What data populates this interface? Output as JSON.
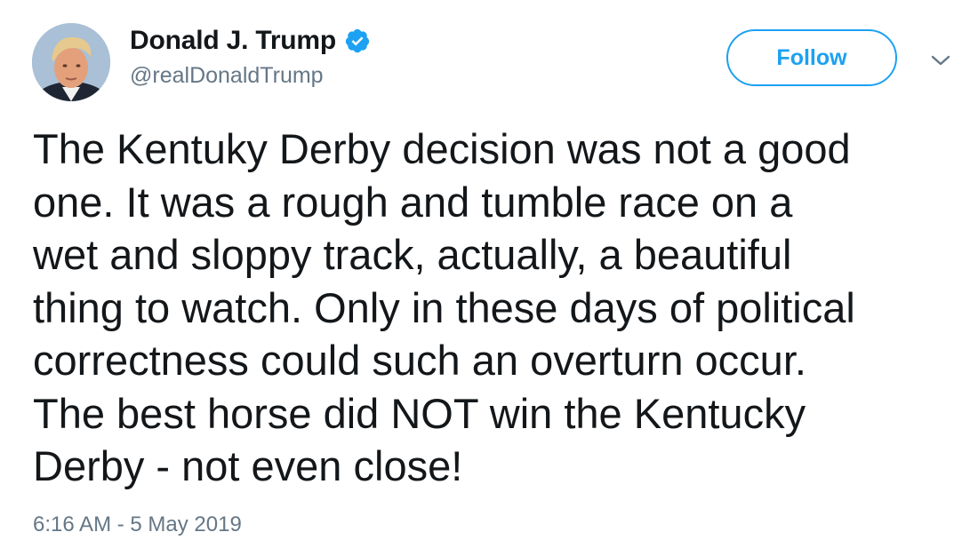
{
  "user": {
    "display_name": "Donald J. Trump",
    "handle": "@realDonaldTrump",
    "verified": true,
    "avatar_icon": "profile-photo"
  },
  "actions": {
    "follow_label": "Follow",
    "more_icon": "chevron-down-icon"
  },
  "tweet": {
    "text_lines": [
      "The Kentuky Derby decision was not a good",
      "one. It was a rough and tumble race on a",
      "wet and sloppy track, actually, a beautiful",
      "thing to watch. Only in these days of political",
      "correctness could such an overturn occur.",
      "The best horse did NOT win the Kentucky",
      "Derby - not even close!"
    ],
    "timestamp": "6:16 AM - 5 May 2019"
  },
  "colors": {
    "accent": "#1da1f2",
    "text": "#14171a",
    "secondary_text": "#657786"
  }
}
